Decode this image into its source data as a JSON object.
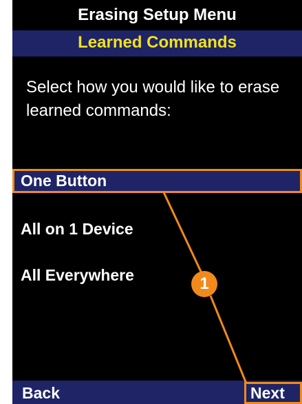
{
  "header": {
    "title": "Erasing Setup Menu",
    "subtitle": "Learned Commands"
  },
  "prompt": {
    "text": "Select how you would like to erase learned commands:"
  },
  "options": [
    {
      "label": "One Button",
      "selected": true
    },
    {
      "label": "All on 1 Device",
      "selected": false
    },
    {
      "label": "All Everywhere",
      "selected": false
    }
  ],
  "softkeys": {
    "left": "Back",
    "right": "Next"
  },
  "callout": {
    "number": "1",
    "color": "#f08a1c"
  },
  "colors": {
    "background": "#000000",
    "bar": "#1e2466",
    "subtitle_text": "#f2e21a",
    "text": "#ffffff"
  }
}
